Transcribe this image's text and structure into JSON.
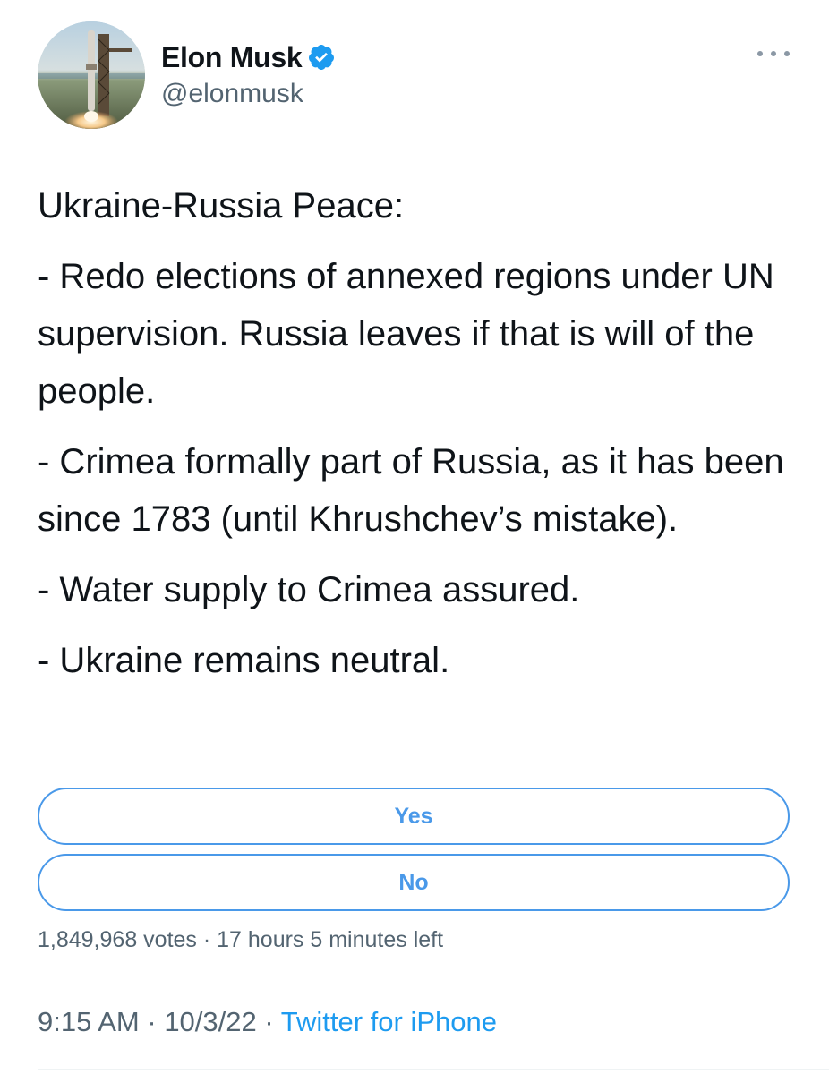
{
  "author": {
    "name": "Elon Musk",
    "handle": "@elonmusk",
    "verified": true,
    "avatar_icon": "starship-launch-tower-avatar"
  },
  "more_icon": "more-horizontal-icon",
  "tweet": {
    "paragraphs": [
      "Ukraine-Russia Peace:",
      "- Redo elections of annexed regions under UN supervision. Russia leaves if that is will of the people.",
      "- Crimea formally part of Russia, as it has been since 1783 (until Khrushchev’s mistake).",
      "- Water supply to Crimea assured.",
      "- Ukraine remains neutral."
    ]
  },
  "poll": {
    "options": [
      "Yes",
      "No"
    ],
    "votes": "1,849,968 votes",
    "separator": " · ",
    "time_left": "17 hours 5 minutes left"
  },
  "meta": {
    "time": "9:15 AM",
    "date": "10/3/22",
    "separator": " · ",
    "source": "Twitter for iPhone"
  },
  "colors": {
    "accent": "#4a99e9",
    "link": "#1d9bf0",
    "secondary_text": "#536471",
    "primary_text": "#0f1419"
  }
}
